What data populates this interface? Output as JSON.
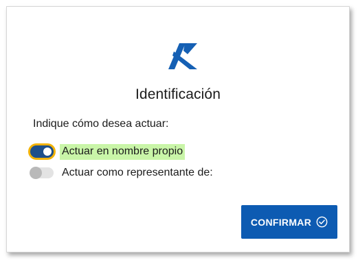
{
  "logo": {
    "icon": "agency-logo-icon",
    "color": "#1560b4"
  },
  "title": "Identificación",
  "prompt": "Indique cómo desea actuar:",
  "options": [
    {
      "label": "Actuar en nombre propio",
      "selected": true
    },
    {
      "label": "Actuar como representante de:",
      "selected": false
    }
  ],
  "confirm_button": {
    "label": "CONFIRMAR",
    "icon": "check-circle-icon"
  },
  "colors": {
    "accent": "#0d5bb2",
    "toggle_on": "#1e4f8a",
    "focus_ring": "#f2b205",
    "highlight": "#c9f5a8"
  }
}
